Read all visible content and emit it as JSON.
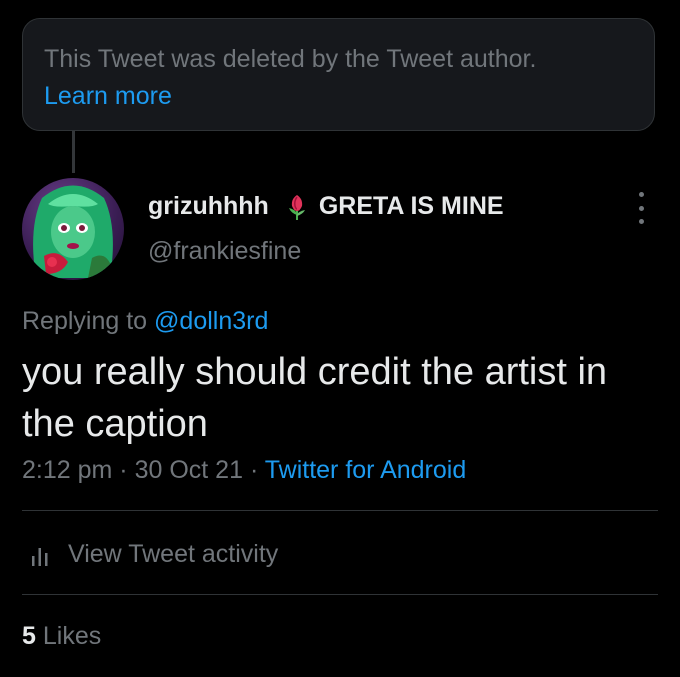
{
  "colors": {
    "background": "#000000",
    "accent": "#1d9bf0",
    "text_primary": "#e7e9ea",
    "text_secondary": "#71767b",
    "border": "#2f3336"
  },
  "deleted_notice": {
    "text": "This Tweet was deleted by the Tweet author.",
    "link_label": "Learn more"
  },
  "author": {
    "display_name": "grizuhhhh",
    "name_emoji": "rose-icon",
    "name_suffix": "GRETA IS MINE",
    "handle": "@frankiesfine",
    "avatar_icon": "avatar-doll-image"
  },
  "reply": {
    "prefix": "Replying to",
    "to_handle": "@dolln3rd"
  },
  "tweet": {
    "text": "you really should credit the artist in the caption",
    "time": "2:12 pm",
    "separator": "·",
    "date": "30 Oct 21",
    "source": "Twitter for Android"
  },
  "activity": {
    "icon": "bar-chart-icon",
    "label": "View Tweet activity"
  },
  "stats": {
    "likes_count": "5",
    "likes_label": "Likes"
  },
  "menu": {
    "icon": "more-vertical-icon"
  }
}
